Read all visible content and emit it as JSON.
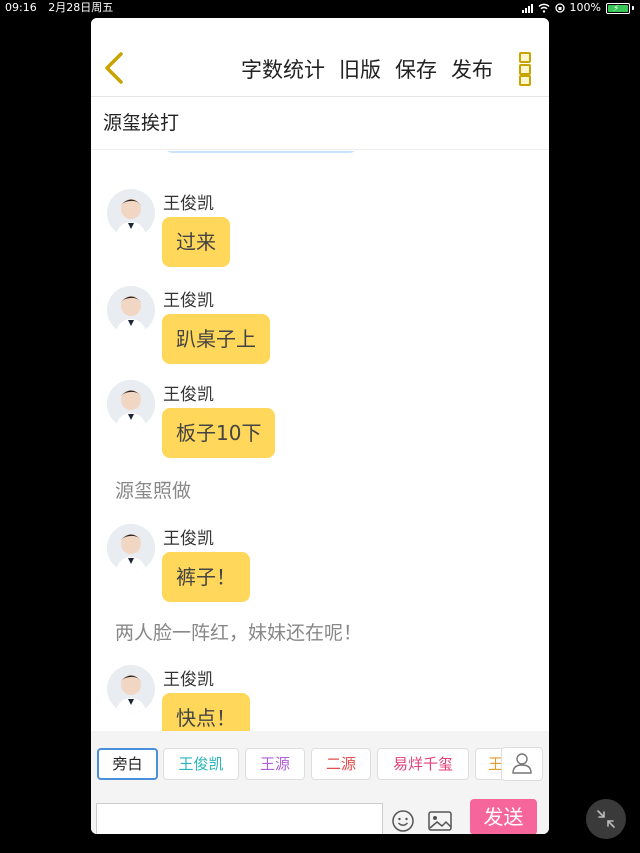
{
  "status_bar": {
    "time": "09:16",
    "date": "2月28日周五",
    "battery": "100%"
  },
  "toolbar": {
    "actions": [
      "字数统计",
      "旧版",
      "保存",
      "发布"
    ]
  },
  "story_title": "源玺挨打",
  "messages": [
    {
      "type": "dialog",
      "speaker": "王俊凯",
      "text": "过来"
    },
    {
      "type": "dialog",
      "speaker": "王俊凯",
      "text": "趴桌子上"
    },
    {
      "type": "dialog",
      "speaker": "王俊凯",
      "text": "板子10下"
    },
    {
      "type": "narration",
      "text": "源玺照做"
    },
    {
      "type": "dialog",
      "speaker": "王俊凯",
      "text": "裤子！"
    },
    {
      "type": "narration",
      "text": "两人脸一阵红，妹妹还在呢！"
    },
    {
      "type": "dialog",
      "speaker": "王俊凯",
      "text": "快点！"
    }
  ],
  "role_chips": [
    {
      "label": "旁白",
      "color": "#222222",
      "active": true
    },
    {
      "label": "王俊凯",
      "color": "#2bb5b8"
    },
    {
      "label": "王源",
      "color": "#b061d6"
    },
    {
      "label": "二源",
      "color": "#e34d4d"
    },
    {
      "label": "易烊千玺",
      "color": "#e0417a"
    },
    {
      "label": "王",
      "color": "#e39b2b"
    }
  ],
  "composer": {
    "input_value": "",
    "input_placeholder": "",
    "send_label": "发送"
  },
  "icons": {
    "back": "chevron-left-icon",
    "more": "more-vertical-icon",
    "person": "person-icon",
    "emoji": "smiley-icon",
    "image": "image-icon",
    "float": "collapse-icon"
  },
  "colors": {
    "bubble": "#ffd75a",
    "send": "#f7669b",
    "accent": "#c9a300"
  }
}
